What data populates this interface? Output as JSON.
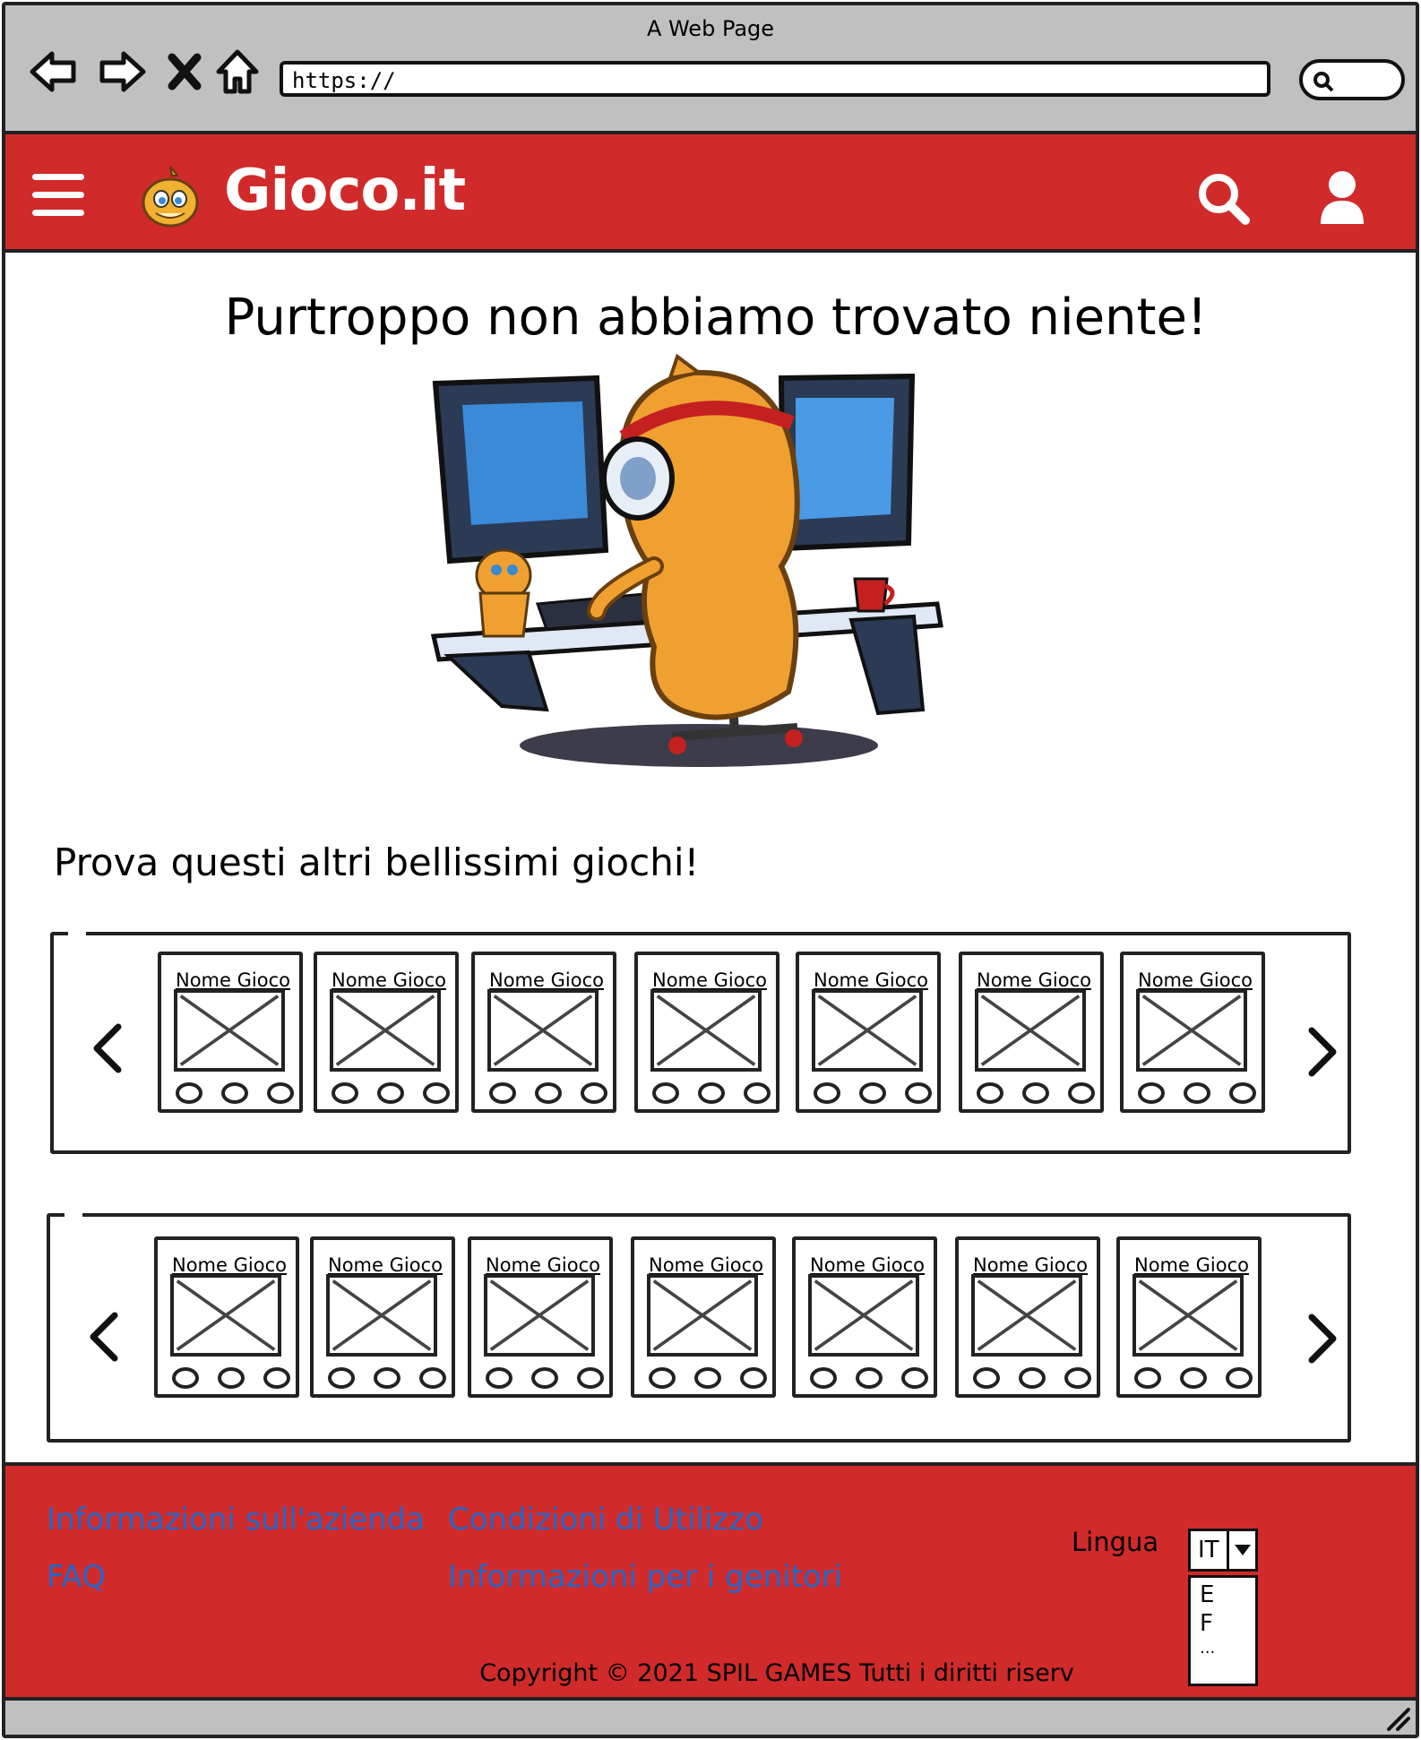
{
  "browser": {
    "window_title": "A Web Page",
    "url": "https://"
  },
  "header": {
    "brand": "Gioco.it",
    "brand_color": "#d12a2a"
  },
  "main": {
    "title": "Purtroppo non abbiamo trovato niente!",
    "section_title": "Prova questi altri bellissimi giochi!"
  },
  "carousels": [
    {
      "cards": [
        {
          "name": "Nome Gioco"
        },
        {
          "name": "Nome Gioco"
        },
        {
          "name": "Nome Gioco"
        },
        {
          "name": "Nome Gioco"
        },
        {
          "name": "Nome Gioco"
        },
        {
          "name": "Nome Gioco"
        },
        {
          "name": "Nome Gioco"
        }
      ]
    },
    {
      "cards": [
        {
          "name": "Nome Gioco"
        },
        {
          "name": "Nome Gioco"
        },
        {
          "name": "Nome Gioco"
        },
        {
          "name": "Nome Gioco"
        },
        {
          "name": "Nome Gioco"
        },
        {
          "name": "Nome Gioco"
        },
        {
          "name": "Nome Gioco"
        }
      ]
    }
  ],
  "footer": {
    "links": {
      "about": "Informazioni sull'azienda",
      "terms": "Condizioni di Utilizzo",
      "faq": "FAQ",
      "parents": "Informazioni per i genitori"
    },
    "language_label": "Lingua",
    "language_selected": "IT",
    "language_options": [
      "E",
      "F",
      "..."
    ],
    "copyright": "Copyright © 2021 SPIL GAMES Tutti i diritti riserv",
    "link_color": "#2366c8"
  }
}
